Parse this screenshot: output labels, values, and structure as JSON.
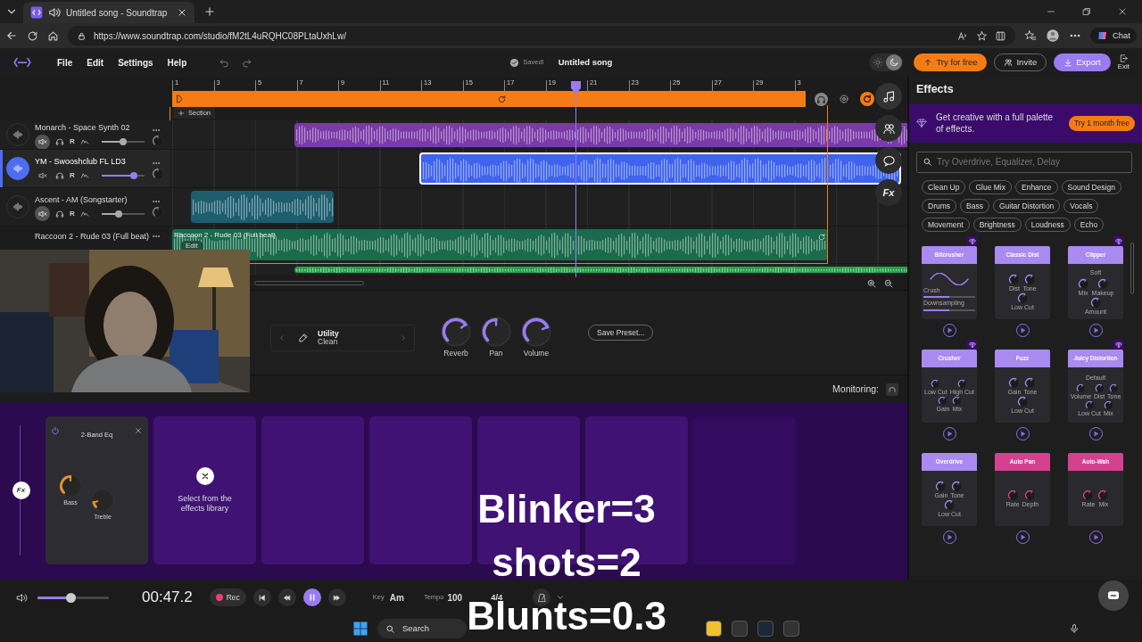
{
  "browser": {
    "tab_title": "Untitled song - Soundtrap",
    "url": "https://www.soundtrap.com/studio/fM2tL4uRQHC08PLtaUxhLw/",
    "chat_button": "Chat"
  },
  "menu": [
    "File",
    "Edit",
    "Settings",
    "Help"
  ],
  "header": {
    "save_status": "Saved!",
    "song_title": "Untitled song",
    "dark_mode": true,
    "try_button": "Try for free",
    "invite_button": "Invite",
    "export_button": "Export",
    "exit_button": "Exit"
  },
  "ruler": [
    "1",
    "3",
    "5",
    "7",
    "9",
    "11",
    "13",
    "15",
    "17",
    "19",
    "21",
    "23",
    "25",
    "27",
    "29",
    "3"
  ],
  "section_button": "Section",
  "tracks": [
    {
      "name": "Monarch - Space Synth 02",
      "selected": false,
      "muted": true,
      "record": "R",
      "color": "#7a3aa8"
    },
    {
      "name": "YM - Swooshclub FL LD3",
      "selected": true,
      "muted": false,
      "record": "R",
      "color": "#3f63ee"
    },
    {
      "name": "Ascent - AM (Songstarter)",
      "selected": false,
      "muted": true,
      "record": "R",
      "color": "#1d5d6e"
    },
    {
      "name": "Raccoon 2 - Rude 03 (Full beat)",
      "selected": false,
      "color": "#1a6b4e",
      "clip_label": "Raccoon 2 - Rude 03 (Full beat)",
      "edit_button": "Edit"
    },
    {
      "color": "#28a04a"
    }
  ],
  "side_fx_button": "Fx",
  "instrument": {
    "name": "Utility",
    "preset": "Clean",
    "knobs": [
      {
        "label": "Reverb"
      },
      {
        "label": "Pan"
      },
      {
        "label": "Volume"
      }
    ],
    "save_button": "Save Preset..."
  },
  "monitoring": "Monitoring:",
  "fx_rack": {
    "fx_label": "Fx",
    "slots": [
      {
        "kind": "effect",
        "name": "2-Band Eq",
        "knobs": [
          {
            "label": "Bass"
          },
          {
            "label": "Treble"
          }
        ]
      },
      {
        "kind": "prompt",
        "text": "Select from the effects library"
      },
      {
        "kind": "empty"
      },
      {
        "kind": "empty"
      },
      {
        "kind": "empty"
      },
      {
        "kind": "empty"
      },
      {
        "kind": "dim"
      }
    ]
  },
  "effects_panel": {
    "title": "Effects",
    "promo": "Get creative with a full palette of effects.",
    "promo_button": "Try 1 month free",
    "search": {
      "placeholder": "Try Overdrive, Equalizer, Delay"
    },
    "tags": [
      "Clean Up",
      "Glue Mix",
      "Enhance",
      "Sound Design",
      "Drums",
      "Bass",
      "Guitar Distortion",
      "Vocals",
      "Movement",
      "Brightness",
      "Loudness",
      "Echo"
    ],
    "cards": [
      {
        "name": "Bitcrusher",
        "premium": true,
        "color": "#a98af0",
        "kind": "sliders",
        "controls": [
          "Crush",
          "Downsampling"
        ]
      },
      {
        "name": "Classic Dist",
        "premium": false,
        "color": "#a98af0",
        "kind": "knobs",
        "controls": [
          "Dist",
          "Tone",
          "Low Cut"
        ]
      },
      {
        "name": "Clipper",
        "premium": true,
        "color": "#a98af0",
        "kind": "knobs",
        "preset": "Soft",
        "controls": [
          "Mix",
          "Makeup",
          "Amount"
        ]
      },
      {
        "name": "Crusher",
        "premium": true,
        "color": "#a98af0",
        "kind": "knobs",
        "controls": [
          "Low Cut",
          "High Cut",
          "Gain",
          "Mix"
        ]
      },
      {
        "name": "Fuzz",
        "premium": false,
        "color": "#a98af0",
        "kind": "knobs",
        "controls": [
          "Gain",
          "Tone",
          "Low Cut"
        ]
      },
      {
        "name": "Juicy Distortion",
        "premium": true,
        "color": "#a98af0",
        "kind": "knobs",
        "preset": "Default",
        "controls": [
          "Volume",
          "Dist",
          "Tone",
          "Low Cut",
          "Mix"
        ]
      },
      {
        "name": "Overdrive",
        "premium": false,
        "color": "#a98af0",
        "kind": "knobs",
        "controls": [
          "Gain",
          "Tone",
          "Low Cut"
        ]
      },
      {
        "name": "Auto Pan",
        "premium": false,
        "color": "#d6418f",
        "kind": "knobs",
        "controls": [
          "Rate",
          "Depth"
        ]
      },
      {
        "name": "Auto-Wah",
        "premium": false,
        "color": "#d6418f",
        "kind": "knobs",
        "controls": [
          "Rate",
          "Mix"
        ]
      }
    ]
  },
  "transport": {
    "time": "00:47.2",
    "record_button": "Rec",
    "playing": true,
    "key_label": "Key",
    "key": "Am",
    "tempo_label": "Tempo",
    "tempo": "100",
    "time_signature": "4/4"
  },
  "taskbar": {
    "search": "Search"
  },
  "overlay_captions": [
    "Blinker=3",
    "shots=2",
    "Blunts=0.3"
  ]
}
